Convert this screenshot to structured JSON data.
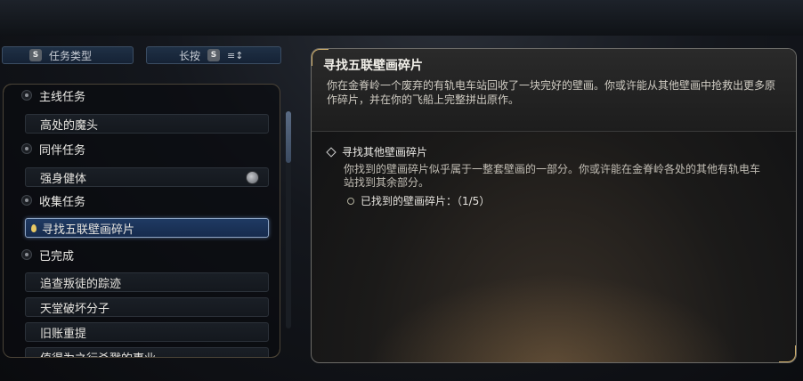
{
  "filter": {
    "type_key": "S",
    "type_label": "任务类型",
    "hold_label": "长按",
    "hold_key": "S",
    "sort_icon": "≡↕"
  },
  "quest_list": {
    "main": "主线任务",
    "main_items": [
      "高处的魔头"
    ],
    "companion": "同伴任务",
    "companion_items": [
      "强身健体"
    ],
    "collect": "收集任务",
    "collect_items": [
      "寻找五联壁画碎片"
    ],
    "completed": "已完成",
    "completed_items": [
      "追查叛徒的踪迹",
      "天堂破坏分子",
      "旧账重提",
      "值得为之行杀戮的事业"
    ]
  },
  "detail": {
    "title": "寻找五联壁画碎片",
    "description": "你在金脊岭一个废弃的有轨电车站回收了一块完好的壁画。你或许能从其他壁画中抢救出更多原作碎片，并在你的飞船上完整拼出原作。",
    "objective_title": "寻找其他壁画碎片",
    "objective_desc": "你找到的壁画碎片似乎属于一整套壁画的一部分。你或许能在金脊岭各处的其他有轨电车站找到其余部分。",
    "sub_objective": "已找到的壁画碎片：（1/5）"
  },
  "colors": {
    "selected_bg": "#1f3a63",
    "gold_accent": "#cfae6a"
  }
}
